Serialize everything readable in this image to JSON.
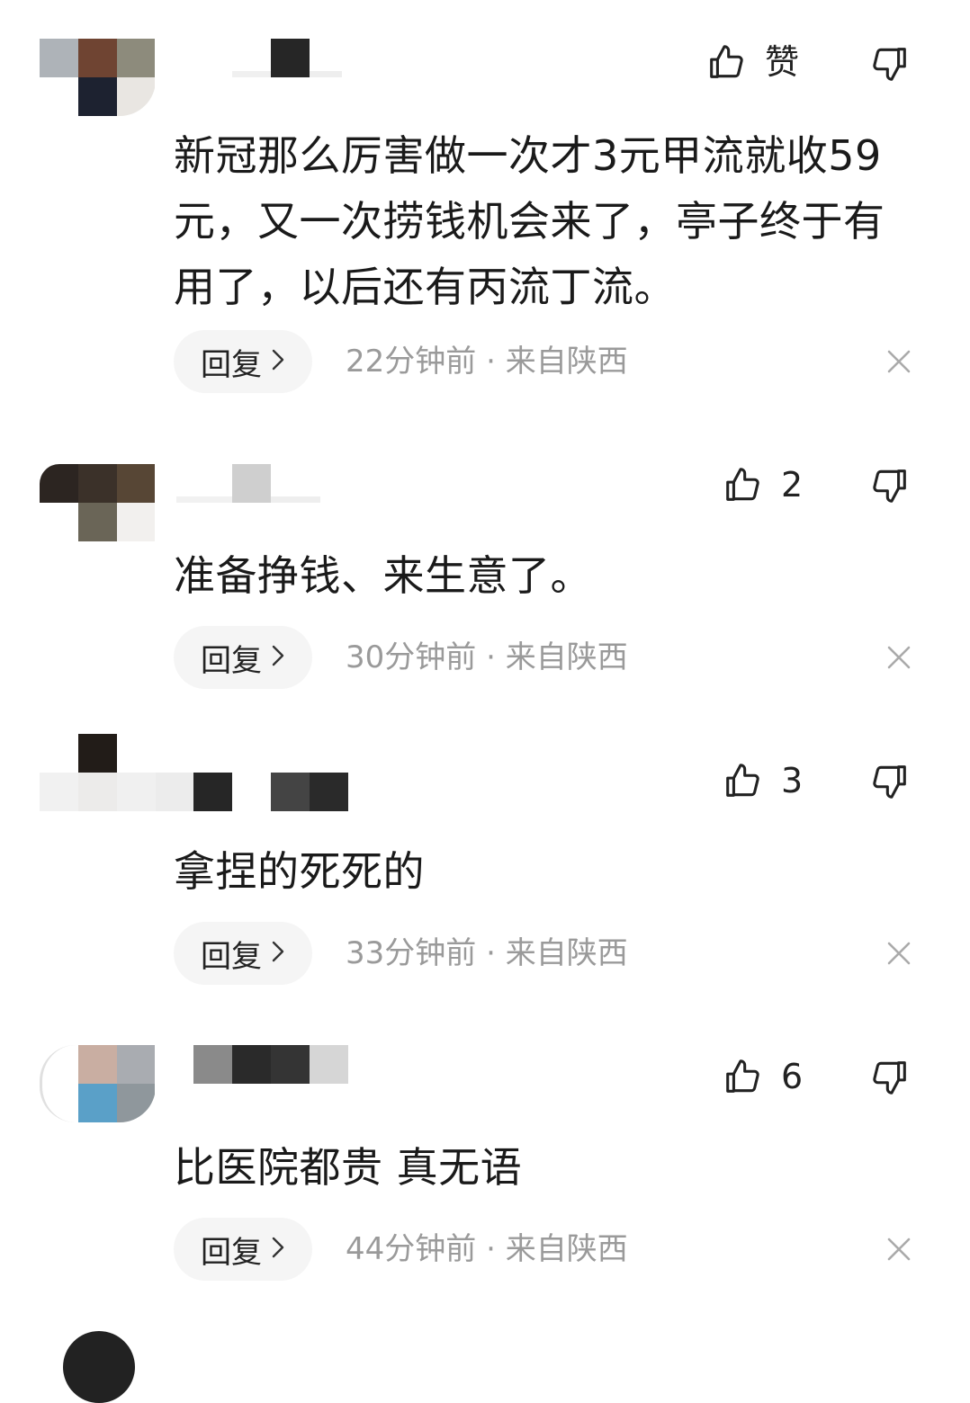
{
  "comments": [
    {
      "like_label": "赞",
      "text": "新冠那么厉害做一次才3元甲流就收59元，又一次捞钱机会来了，亭子终于有用了，以后还有丙流丁流。",
      "reply_label": "回复",
      "time": "22分钟前",
      "location": "来自陕西"
    },
    {
      "like_label": "2",
      "text": "准备挣钱、来生意了。",
      "reply_label": "回复",
      "time": "30分钟前",
      "location": "来自陕西"
    },
    {
      "like_label": "3",
      "text": "拿捏的死死的",
      "reply_label": "回复",
      "time": "33分钟前",
      "location": "来自陕西"
    },
    {
      "like_label": "6",
      "text": "比医院都贵 真无语",
      "reply_label": "回复",
      "time": "44分钟前",
      "location": "来自陕西"
    }
  ],
  "meta_separator": " · ",
  "icons": {
    "like": "thumbs-up-icon",
    "dislike": "thumbs-down-icon",
    "close": "close-icon",
    "chevron": "chevron-right-icon"
  },
  "colors": {
    "meta_text": "#9a9a9a",
    "reply_bg": "#f5f5f5",
    "text": "#1a1a1a"
  }
}
